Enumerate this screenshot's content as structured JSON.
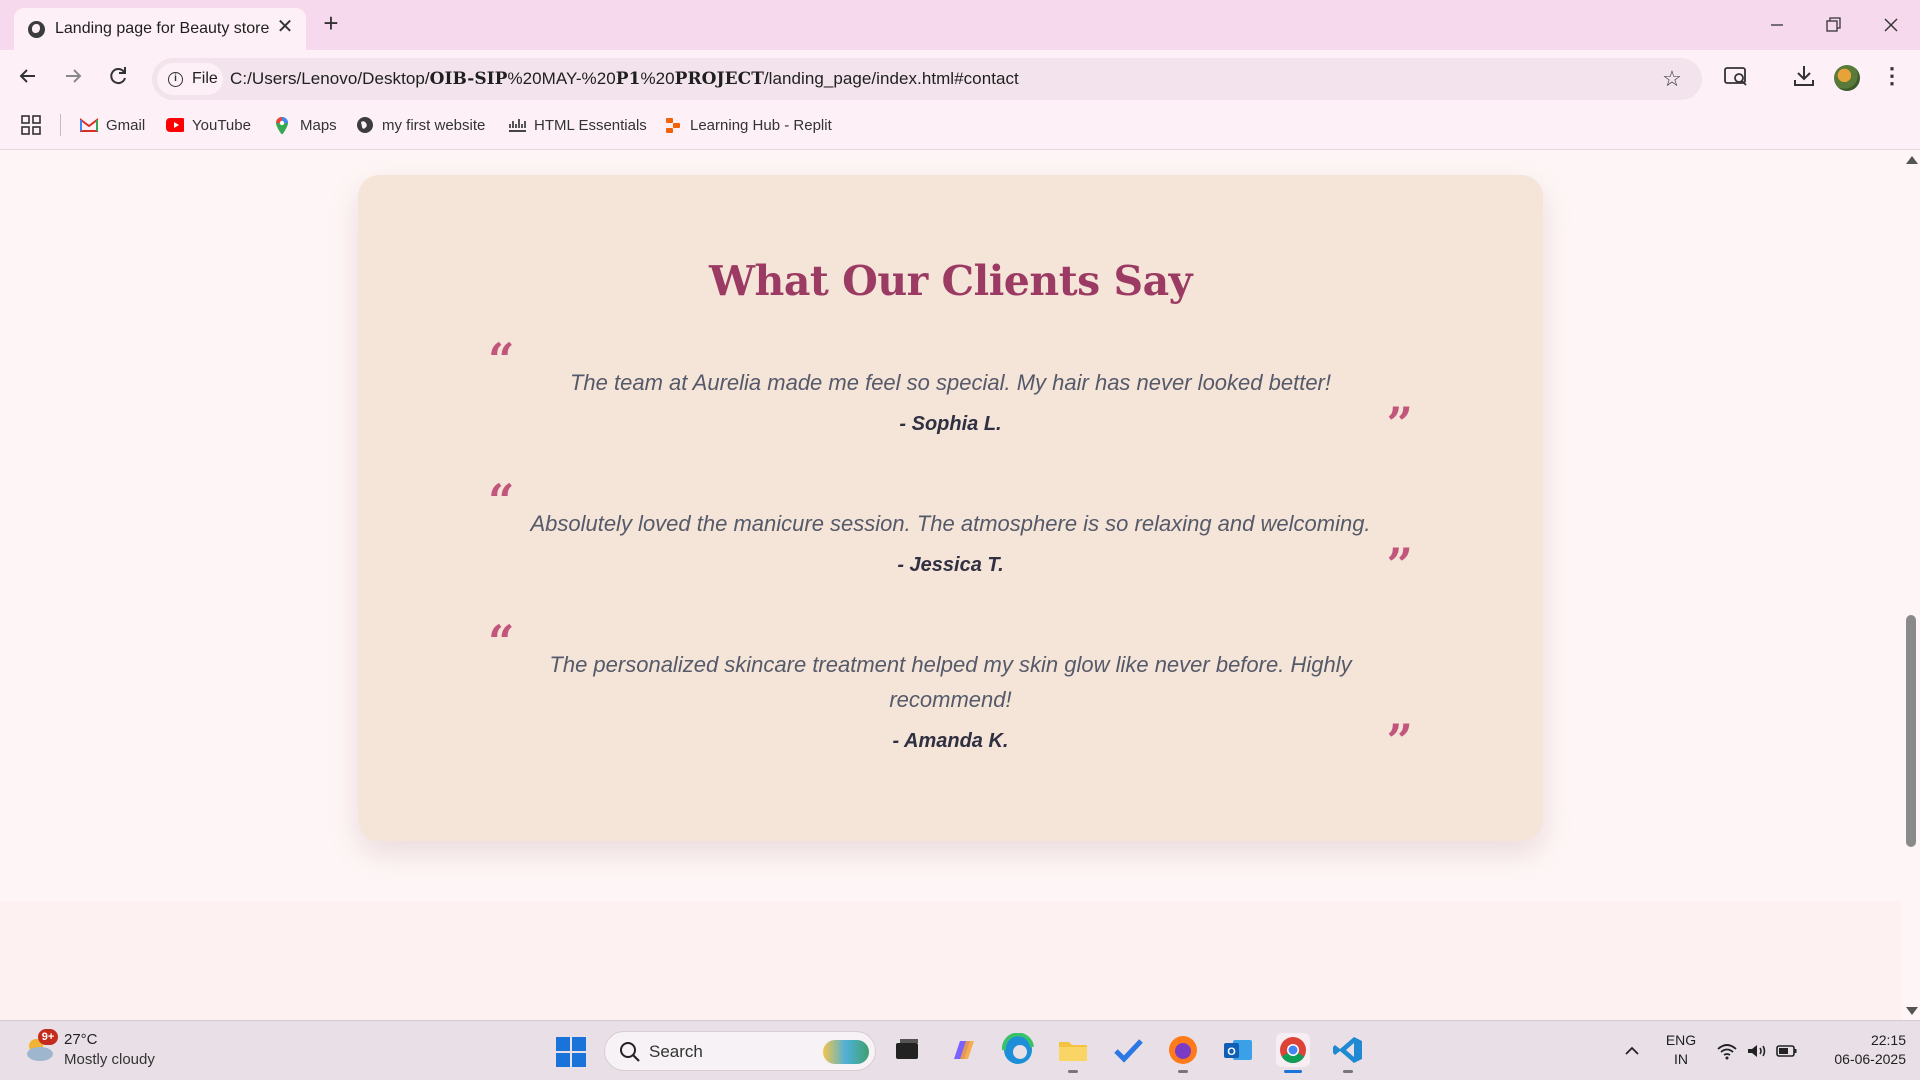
{
  "browser": {
    "tab": {
      "title": "Landing page for Beauty store",
      "close": "✕"
    },
    "new_tab": "+",
    "window": {
      "minimize": "—",
      "maximize": "❐",
      "close": "✕"
    },
    "chip_label": "File",
    "url": {
      "part1": "C:/Users/Lenovo/Desktop/",
      "part2": "OIB-SIP",
      "part3": "%20MAY-%20",
      "part4": "P1",
      "part5": "%20",
      "part6": "PROJECT",
      "part7": "/landing_page/index.html#contact"
    },
    "bookmarks": [
      {
        "label": "Gmail"
      },
      {
        "label": "YouTube"
      },
      {
        "label": "Maps"
      },
      {
        "label": "my first website"
      },
      {
        "label": "HTML Essentials"
      },
      {
        "label": "Learning Hub - Replit"
      }
    ]
  },
  "page": {
    "testimonials_title": "What Our Clients Say",
    "open_quote": "“",
    "close_quote": "”",
    "testimonials": [
      {
        "text": "The team at Aurelia made me feel so special. My hair has never looked better!",
        "author": "- Sophia L."
      },
      {
        "text": "Absolutely loved the manicure session. The atmosphere is so relaxing and welcoming.",
        "author": "- Jessica T."
      },
      {
        "text": "The personalized skincare treatment helped my skin glow like never before. Highly recommend!",
        "author": "- Amanda K."
      }
    ]
  },
  "taskbar": {
    "weather": {
      "badge": "9+",
      "temp": "27°C",
      "desc": "Mostly cloudy"
    },
    "search_label": "Search",
    "lang_line1": "ENG",
    "lang_line2": "IN",
    "time": "22:15",
    "date": "06-06-2025"
  },
  "colors": {
    "accent": "#9b3a62",
    "quote_mark": "#c2557c",
    "card_bg": "#f5e4d8",
    "page_bg": "#fef6f6"
  }
}
